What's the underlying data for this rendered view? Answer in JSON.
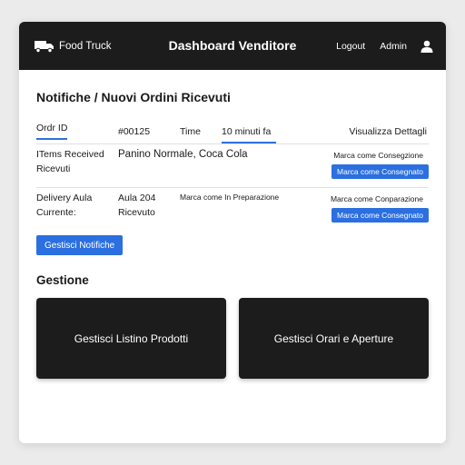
{
  "topbar": {
    "brand_label": "Food Truck",
    "title": "Dashboard Venditore",
    "logout_label": "Logout",
    "admin_label": "Admin"
  },
  "notifications": {
    "title": "Notifiche / Nuovi Ordini Ricevuti",
    "header": {
      "order_id_label": "Ordr ID",
      "order_id_value": "#00125",
      "time_label": "Time",
      "time_value": "10 minuti fa",
      "details_label": "Visualizza Dettagli"
    },
    "items_row": {
      "label": "ITems Received Ricevuti",
      "value": "Panino Normale, Coca Cola",
      "action_label": "Marca come Consegzione",
      "action_button": "Marca come Consegnato"
    },
    "delivery_row": {
      "label": "Delivery Aula Currente:",
      "value": "Aula 204 Ricevuto",
      "status": "Marca come In Preparazione",
      "action_label": "Marca come Conparazione",
      "action_button": "Marca come Consegnato"
    },
    "manage_button": "Gestisci Notifiche"
  },
  "management": {
    "title": "Gestione",
    "cards": [
      "Gestisci Listino Prodotti",
      "Gestisci Orari e Aperture"
    ]
  },
  "colors": {
    "topbar": "#1c1c1c",
    "accent": "#2b6fe0",
    "background": "#ebebeb"
  },
  "icons": {
    "brand": "truck-icon",
    "user": "user-icon"
  }
}
